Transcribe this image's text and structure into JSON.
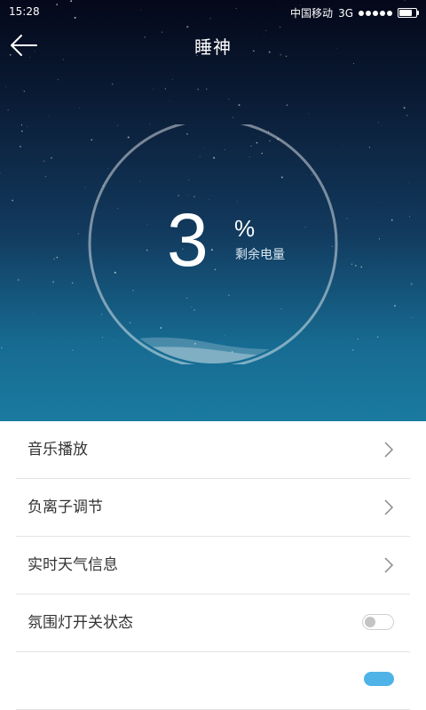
{
  "status_bar": {
    "time": "15:28",
    "carrier": "中国移动",
    "network": "3G",
    "signal_bars": 5,
    "battery_level": 0.8
  },
  "header": {
    "title": "睡神",
    "back_icon": "arrow-left-icon"
  },
  "gauge": {
    "value": "3",
    "unit": "%",
    "label": "剩余电量",
    "fill_fraction": 0.03
  },
  "menu": {
    "items": [
      {
        "label": "音乐播放",
        "control": "chevron-right-icon"
      },
      {
        "label": "负离子调节",
        "control": "chevron-right-icon"
      },
      {
        "label": "实时天气信息",
        "control": "chevron-right-icon"
      },
      {
        "label": "氛围灯开关状态",
        "control": "toggle",
        "state": "off"
      }
    ]
  },
  "colors": {
    "hero_top": "#04081a",
    "hero_bottom": "#1a7aa0",
    "text_primary": "#333333",
    "divider": "#e3e3e3"
  }
}
